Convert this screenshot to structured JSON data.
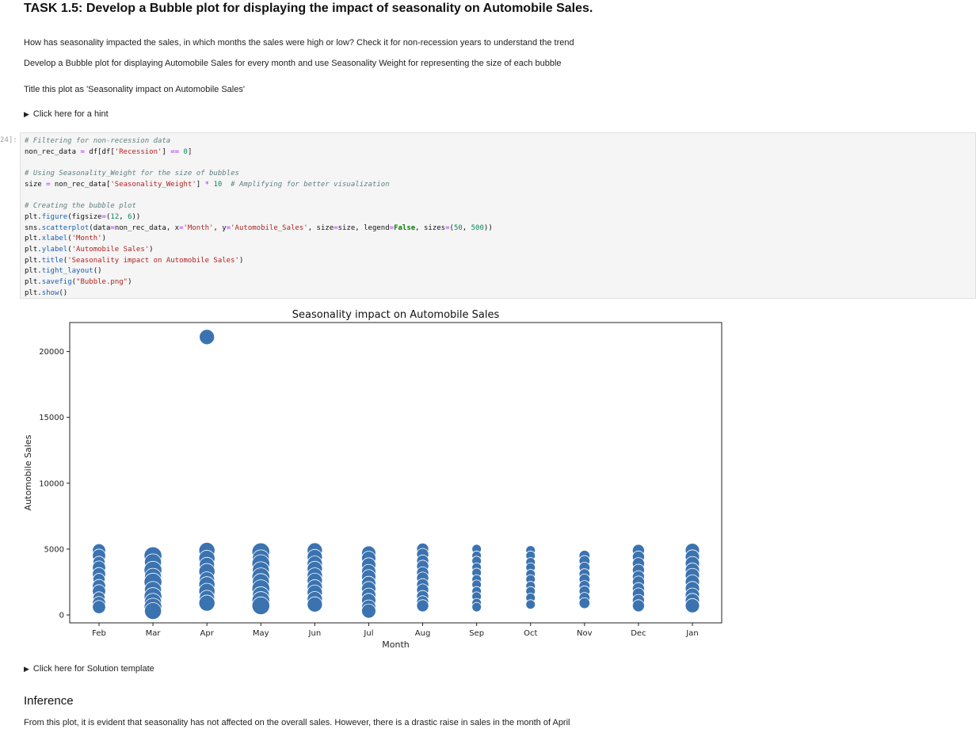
{
  "task": {
    "title": "TASK 1.5: Develop a Bubble plot for displaying the impact of seasonality on Automobile Sales.",
    "question": "How has seasonality impacted the sales, in which months the sales were high or low? Check it for non-recession years to understand the trend",
    "instruction": "Develop a Bubble plot for displaying Automobile Sales for every month and use Seasonality Weight for representing the size of each bubble",
    "title_instruction": "Title this plot as 'Seasonality impact on Automobile Sales'",
    "hint_label": "Click here for a hint",
    "solution_label": "Click here for Solution template"
  },
  "cell": {
    "prompt": "24]:"
  },
  "code": {
    "l1": "# Filtering for non-recession data",
    "l2a": "non_rec_data ",
    "l2b": "=",
    "l2c": " df[df[",
    "l2d": "'Recession'",
    "l2e": "] ",
    "l2f": "==",
    "l2g": " ",
    "l2h": "0",
    "l2i": "]",
    "l3": "# Using Seasonality_Weight for the size of bubbles",
    "l4a": "size ",
    "l4b": "=",
    "l4c": " non_rec_data[",
    "l4d": "'Seasonality_Weight'",
    "l4e": "] ",
    "l4f": "*",
    "l4g": " ",
    "l4h": "10",
    "l4i": "  ",
    "l4j": "# Amplifying for better visualization",
    "l5": "# Creating the bubble plot",
    "l6a": "plt.",
    "l6b": "figure",
    "l6c": "(figsize",
    "l6d": "=",
    "l6e": "(",
    "l6f": "12",
    "l6g": ", ",
    "l6h": "6",
    "l6i": "))",
    "l7a": "sns.",
    "l7b": "scatterplot",
    "l7c": "(data",
    "l7d": "=",
    "l7e": "non_rec_data, x",
    "l7f": "=",
    "l7g": "'Month'",
    "l7h": ", y",
    "l7i": "=",
    "l7j": "'Automobile_Sales'",
    "l7k": ", size",
    "l7l": "=",
    "l7m": "size, legend",
    "l7n": "=",
    "l7o": "False",
    "l7p": ", sizes",
    "l7q": "=",
    "l7r": "(",
    "l7s": "50",
    "l7t": ", ",
    "l7u": "500",
    "l7v": "))",
    "l8a": "plt.",
    "l8b": "xlabel",
    "l8c": "(",
    "l8d": "'Month'",
    "l8e": ")",
    "l9a": "plt.",
    "l9b": "ylabel",
    "l9c": "(",
    "l9d": "'Automobile Sales'",
    "l9e": ")",
    "l10a": "plt.",
    "l10b": "title",
    "l10c": "(",
    "l10d": "'Seasonality impact on Automobile Sales'",
    "l10e": ")",
    "l11a": "plt.",
    "l11b": "tight_layout",
    "l11c": "()",
    "l12a": "plt.",
    "l12b": "savefig",
    "l12c": "(",
    "l12d": "\"Bubble.png\"",
    "l12e": ")",
    "l13a": "plt.",
    "l13b": "show",
    "l13c": "()"
  },
  "inference": {
    "heading": "Inference",
    "text": "From this plot, it is evident that seasonality has not affected on the overall sales. However, there is a drastic raise in sales in the month of April"
  },
  "colors": {
    "bubble": "#3b73b0",
    "bubble_edge": "#ffffff"
  },
  "chart_data": {
    "type": "scatter",
    "title": "Seasonality impact on Automobile Sales",
    "xlabel": "Month",
    "ylabel": "Automobile Sales",
    "categories": [
      "Feb",
      "Mar",
      "Apr",
      "May",
      "Jun",
      "Jul",
      "Aug",
      "Sep",
      "Oct",
      "Nov",
      "Dec",
      "Jan"
    ],
    "ylim": [
      -600,
      22200
    ],
    "yticks": [
      0,
      5000,
      10000,
      15000,
      20000
    ],
    "grid": false,
    "legend": false,
    "points": [
      {
        "month": "Feb",
        "sales": 4900,
        "weight": 0.5
      },
      {
        "month": "Feb",
        "sales": 4500,
        "weight": 0.5
      },
      {
        "month": "Feb",
        "sales": 4000,
        "weight": 0.4
      },
      {
        "month": "Feb",
        "sales": 3600,
        "weight": 0.5
      },
      {
        "month": "Feb",
        "sales": 3100,
        "weight": 0.5
      },
      {
        "month": "Feb",
        "sales": 2700,
        "weight": 0.4
      },
      {
        "month": "Feb",
        "sales": 2200,
        "weight": 0.5
      },
      {
        "month": "Feb",
        "sales": 1800,
        "weight": 0.5
      },
      {
        "month": "Feb",
        "sales": 1300,
        "weight": 0.4
      },
      {
        "month": "Feb",
        "sales": 900,
        "weight": 0.5
      },
      {
        "month": "Feb",
        "sales": 600,
        "weight": 0.5
      },
      {
        "month": "Mar",
        "sales": 4500,
        "weight": 1.0
      },
      {
        "month": "Mar",
        "sales": 4000,
        "weight": 0.9
      },
      {
        "month": "Mar",
        "sales": 3400,
        "weight": 1.0
      },
      {
        "month": "Mar",
        "sales": 2900,
        "weight": 0.9
      },
      {
        "month": "Mar",
        "sales": 2500,
        "weight": 1.0
      },
      {
        "month": "Mar",
        "sales": 1900,
        "weight": 0.9
      },
      {
        "month": "Mar",
        "sales": 1400,
        "weight": 1.0
      },
      {
        "month": "Mar",
        "sales": 1000,
        "weight": 0.9
      },
      {
        "month": "Mar",
        "sales": 600,
        "weight": 1.0
      },
      {
        "month": "Mar",
        "sales": 300,
        "weight": 0.9
      },
      {
        "month": "Apr",
        "sales": 21100,
        "weight": 0.7
      },
      {
        "month": "Apr",
        "sales": 4900,
        "weight": 0.8
      },
      {
        "month": "Apr",
        "sales": 4300,
        "weight": 0.8
      },
      {
        "month": "Apr",
        "sales": 3800,
        "weight": 0.7
      },
      {
        "month": "Apr",
        "sales": 3300,
        "weight": 0.8
      },
      {
        "month": "Apr",
        "sales": 2700,
        "weight": 0.7
      },
      {
        "month": "Apr",
        "sales": 2300,
        "weight": 0.8
      },
      {
        "month": "Apr",
        "sales": 1800,
        "weight": 0.8
      },
      {
        "month": "Apr",
        "sales": 1300,
        "weight": 0.7
      },
      {
        "month": "Apr",
        "sales": 900,
        "weight": 0.8
      },
      {
        "month": "May",
        "sales": 4800,
        "weight": 1.0
      },
      {
        "month": "May",
        "sales": 4300,
        "weight": 0.9
      },
      {
        "month": "May",
        "sales": 3900,
        "weight": 1.0
      },
      {
        "month": "May",
        "sales": 3400,
        "weight": 0.9
      },
      {
        "month": "May",
        "sales": 2900,
        "weight": 1.0
      },
      {
        "month": "May",
        "sales": 2500,
        "weight": 0.9
      },
      {
        "month": "May",
        "sales": 2000,
        "weight": 1.0
      },
      {
        "month": "May",
        "sales": 1500,
        "weight": 0.9
      },
      {
        "month": "May",
        "sales": 1100,
        "weight": 1.0
      },
      {
        "month": "May",
        "sales": 700,
        "weight": 1.0
      },
      {
        "month": "Jun",
        "sales": 4900,
        "weight": 0.7
      },
      {
        "month": "Jun",
        "sales": 4400,
        "weight": 0.7
      },
      {
        "month": "Jun",
        "sales": 3900,
        "weight": 0.7
      },
      {
        "month": "Jun",
        "sales": 3500,
        "weight": 0.7
      },
      {
        "month": "Jun",
        "sales": 3000,
        "weight": 0.7
      },
      {
        "month": "Jun",
        "sales": 2600,
        "weight": 0.7
      },
      {
        "month": "Jun",
        "sales": 2100,
        "weight": 0.7
      },
      {
        "month": "Jun",
        "sales": 1700,
        "weight": 0.7
      },
      {
        "month": "Jun",
        "sales": 1200,
        "weight": 0.7
      },
      {
        "month": "Jun",
        "sales": 800,
        "weight": 0.7
      },
      {
        "month": "Jul",
        "sales": 4700,
        "weight": 0.6
      },
      {
        "month": "Jul",
        "sales": 4300,
        "weight": 0.6
      },
      {
        "month": "Jul",
        "sales": 3800,
        "weight": 0.6
      },
      {
        "month": "Jul",
        "sales": 3300,
        "weight": 0.6
      },
      {
        "month": "Jul",
        "sales": 2900,
        "weight": 0.6
      },
      {
        "month": "Jul",
        "sales": 2400,
        "weight": 0.6
      },
      {
        "month": "Jul",
        "sales": 2000,
        "weight": 0.6
      },
      {
        "month": "Jul",
        "sales": 1500,
        "weight": 0.6
      },
      {
        "month": "Jul",
        "sales": 1100,
        "weight": 0.6
      },
      {
        "month": "Jul",
        "sales": 600,
        "weight": 0.6
      },
      {
        "month": "Jul",
        "sales": 300,
        "weight": 0.6
      },
      {
        "month": "Aug",
        "sales": 5000,
        "weight": 0.4
      },
      {
        "month": "Aug",
        "sales": 4600,
        "weight": 0.4
      },
      {
        "month": "Aug",
        "sales": 4100,
        "weight": 0.4
      },
      {
        "month": "Aug",
        "sales": 3700,
        "weight": 0.4
      },
      {
        "month": "Aug",
        "sales": 3200,
        "weight": 0.4
      },
      {
        "month": "Aug",
        "sales": 2800,
        "weight": 0.4
      },
      {
        "month": "Aug",
        "sales": 2300,
        "weight": 0.4
      },
      {
        "month": "Aug",
        "sales": 1900,
        "weight": 0.4
      },
      {
        "month": "Aug",
        "sales": 1400,
        "weight": 0.4
      },
      {
        "month": "Aug",
        "sales": 1000,
        "weight": 0.4
      },
      {
        "month": "Aug",
        "sales": 700,
        "weight": 0.4
      },
      {
        "month": "Sep",
        "sales": 5000,
        "weight": 0.2
      },
      {
        "month": "Sep",
        "sales": 4500,
        "weight": 0.2
      },
      {
        "month": "Sep",
        "sales": 4100,
        "weight": 0.2
      },
      {
        "month": "Sep",
        "sales": 3600,
        "weight": 0.2
      },
      {
        "month": "Sep",
        "sales": 3200,
        "weight": 0.2
      },
      {
        "month": "Sep",
        "sales": 2700,
        "weight": 0.2
      },
      {
        "month": "Sep",
        "sales": 2300,
        "weight": 0.2
      },
      {
        "month": "Sep",
        "sales": 1800,
        "weight": 0.2
      },
      {
        "month": "Sep",
        "sales": 1400,
        "weight": 0.2
      },
      {
        "month": "Sep",
        "sales": 900,
        "weight": 0.2
      },
      {
        "month": "Sep",
        "sales": 600,
        "weight": 0.2
      },
      {
        "month": "Oct",
        "sales": 4900,
        "weight": 0.2
      },
      {
        "month": "Oct",
        "sales": 4500,
        "weight": 0.2
      },
      {
        "month": "Oct",
        "sales": 4000,
        "weight": 0.2
      },
      {
        "month": "Oct",
        "sales": 3600,
        "weight": 0.2
      },
      {
        "month": "Oct",
        "sales": 3100,
        "weight": 0.2
      },
      {
        "month": "Oct",
        "sales": 2700,
        "weight": 0.2
      },
      {
        "month": "Oct",
        "sales": 2200,
        "weight": 0.2
      },
      {
        "month": "Oct",
        "sales": 1800,
        "weight": 0.2
      },
      {
        "month": "Oct",
        "sales": 1300,
        "weight": 0.2
      },
      {
        "month": "Oct",
        "sales": 800,
        "weight": 0.2
      },
      {
        "month": "Nov",
        "sales": 4500,
        "weight": 0.3
      },
      {
        "month": "Nov",
        "sales": 4100,
        "weight": 0.3
      },
      {
        "month": "Nov",
        "sales": 3600,
        "weight": 0.3
      },
      {
        "month": "Nov",
        "sales": 3100,
        "weight": 0.3
      },
      {
        "month": "Nov",
        "sales": 2700,
        "weight": 0.3
      },
      {
        "month": "Nov",
        "sales": 2200,
        "weight": 0.3
      },
      {
        "month": "Nov",
        "sales": 1800,
        "weight": 0.3
      },
      {
        "month": "Nov",
        "sales": 1300,
        "weight": 0.3
      },
      {
        "month": "Nov",
        "sales": 900,
        "weight": 0.3
      },
      {
        "month": "Dec",
        "sales": 4900,
        "weight": 0.4
      },
      {
        "month": "Dec",
        "sales": 4400,
        "weight": 0.4
      },
      {
        "month": "Dec",
        "sales": 3900,
        "weight": 0.4
      },
      {
        "month": "Dec",
        "sales": 3400,
        "weight": 0.4
      },
      {
        "month": "Dec",
        "sales": 2900,
        "weight": 0.4
      },
      {
        "month": "Dec",
        "sales": 2500,
        "weight": 0.4
      },
      {
        "month": "Dec",
        "sales": 2000,
        "weight": 0.4
      },
      {
        "month": "Dec",
        "sales": 1600,
        "weight": 0.4
      },
      {
        "month": "Dec",
        "sales": 1100,
        "weight": 0.4
      },
      {
        "month": "Dec",
        "sales": 700,
        "weight": 0.4
      },
      {
        "month": "Jan",
        "sales": 4900,
        "weight": 0.6
      },
      {
        "month": "Jan",
        "sales": 4400,
        "weight": 0.6
      },
      {
        "month": "Jan",
        "sales": 3900,
        "weight": 0.6
      },
      {
        "month": "Jan",
        "sales": 3400,
        "weight": 0.6
      },
      {
        "month": "Jan",
        "sales": 3000,
        "weight": 0.6
      },
      {
        "month": "Jan",
        "sales": 2500,
        "weight": 0.6
      },
      {
        "month": "Jan",
        "sales": 2000,
        "weight": 0.6
      },
      {
        "month": "Jan",
        "sales": 1500,
        "weight": 0.6
      },
      {
        "month": "Jan",
        "sales": 1100,
        "weight": 0.6
      },
      {
        "month": "Jan",
        "sales": 700,
        "weight": 0.6
      }
    ]
  }
}
